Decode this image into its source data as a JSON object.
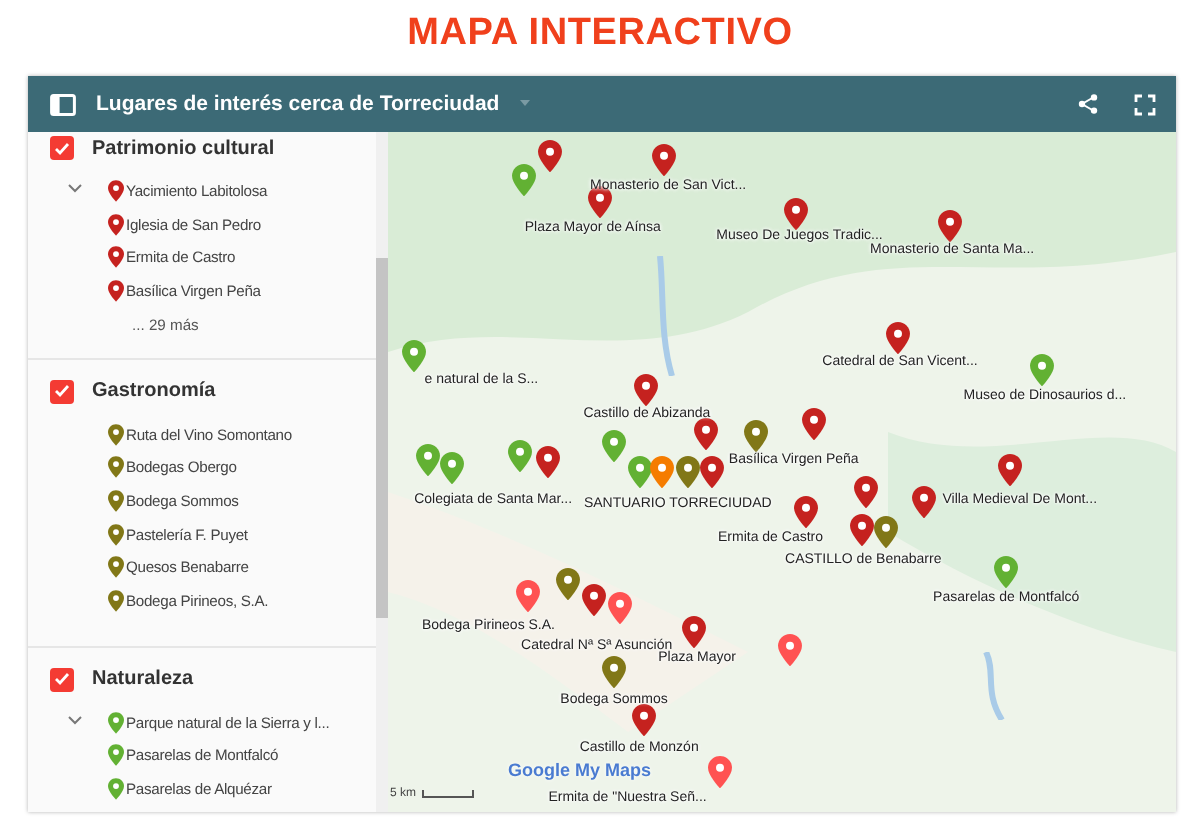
{
  "page_title": "MAPA INTERACTIVO",
  "map_header": {
    "title": "Lugares de interés cerca de Torreciudad"
  },
  "layers": [
    {
      "title": "Patrimonio cultural",
      "checked": true,
      "collapsible": true,
      "items": [
        {
          "label": "Yacimiento Labitolosa",
          "color": "#c5221f"
        },
        {
          "label": "Iglesia de San Pedro",
          "color": "#c5221f"
        },
        {
          "label": "Ermita de Castro",
          "color": "#c5221f"
        },
        {
          "label": "Basílica Virgen Peña",
          "color": "#c5221f"
        }
      ],
      "more": "... 29 más"
    },
    {
      "title": "Gastronomía",
      "checked": true,
      "collapsible": false,
      "items": [
        {
          "label": "Ruta del Vino Somontano",
          "color": "#817717"
        },
        {
          "label": "Bodegas Obergo",
          "color": "#817717"
        },
        {
          "label": "Bodega Sommos",
          "color": "#817717"
        },
        {
          "label": "Pastelería F. Puyet",
          "color": "#817717"
        },
        {
          "label": "Quesos Benabarre",
          "color": "#817717"
        },
        {
          "label": "Bodega Pirineos, S.A.",
          "color": "#817717"
        }
      ]
    },
    {
      "title": "Naturaleza",
      "checked": true,
      "collapsible": true,
      "items": [
        {
          "label": "Parque natural de la Sierra y l...",
          "color": "#62b133"
        },
        {
          "label": "Pasarelas de Montfalcó",
          "color": "#62b133"
        },
        {
          "label": "Pasarelas de Alquézar",
          "color": "#62b133"
        }
      ]
    }
  ],
  "markers": [
    {
      "color": "#c5221f"
    },
    {
      "color": "#c5221f",
      "label": "Monasterio de San Vict..."
    },
    {
      "color": "#62b133"
    },
    {
      "color": "#c5221f",
      "label": "Plaza Mayor de Aínsa"
    },
    {
      "color": "#c5221f",
      "label": "Museo De Juegos Tradic..."
    },
    {
      "color": "#c5221f",
      "label": "Monasterio de Santa Ma..."
    },
    {
      "color": "#c5221f",
      "label": "Catedral de San Vicent..."
    },
    {
      "color": "#62b133",
      "label": "e natural de la S..."
    },
    {
      "color": "#62b133",
      "label": "Museo de Dinosaurios d..."
    },
    {
      "color": "#c5221f",
      "label": "Castillo de Abizanda"
    },
    {
      "color": "#c5221f"
    },
    {
      "color": "#c5221f"
    },
    {
      "color": "#817717",
      "label": "Basílica Virgen Peña"
    },
    {
      "color": "#62b133"
    },
    {
      "color": "#62b133"
    },
    {
      "color": "#62b133"
    },
    {
      "color": "#c5221f",
      "label": "Colegiata de Santa Mar..."
    },
    {
      "color": "#62b133"
    },
    {
      "color": "#62b133"
    },
    {
      "color": "#f57c00",
      "label": "SANTUARIO TORRECIUDAD"
    },
    {
      "color": "#817717"
    },
    {
      "color": "#c5221f"
    },
    {
      "color": "#c5221f",
      "label": "Villa Medieval De Mont..."
    },
    {
      "color": "#c5221f"
    },
    {
      "color": "#c5221f"
    },
    {
      "color": "#c5221f",
      "label": "Ermita de Castro"
    },
    {
      "color": "#c5221f",
      "label": "CASTILLO de Benabarre"
    },
    {
      "color": "#817717"
    },
    {
      "color": "#62b133",
      "label": "Pasarelas de Montfalcó"
    },
    {
      "color": "#817717"
    },
    {
      "color": "#ff5252",
      "label": "Bodega Pirineos S.A."
    },
    {
      "color": "#c5221f"
    },
    {
      "color": "#ff5252",
      "label": "Catedral Nª Sª Asunción"
    },
    {
      "color": "#c5221f",
      "label": "Plaza Mayor"
    },
    {
      "color": "#ff5252"
    },
    {
      "color": "#817717",
      "label": "Bodega Sommos"
    },
    {
      "color": "#c5221f",
      "label": "Castillo de Monzón"
    },
    {
      "color": "#ff5252",
      "label": "Ermita de \"Nuestra Señ..."
    }
  ],
  "map_logo": "Google My Maps",
  "scale": "5 km"
}
